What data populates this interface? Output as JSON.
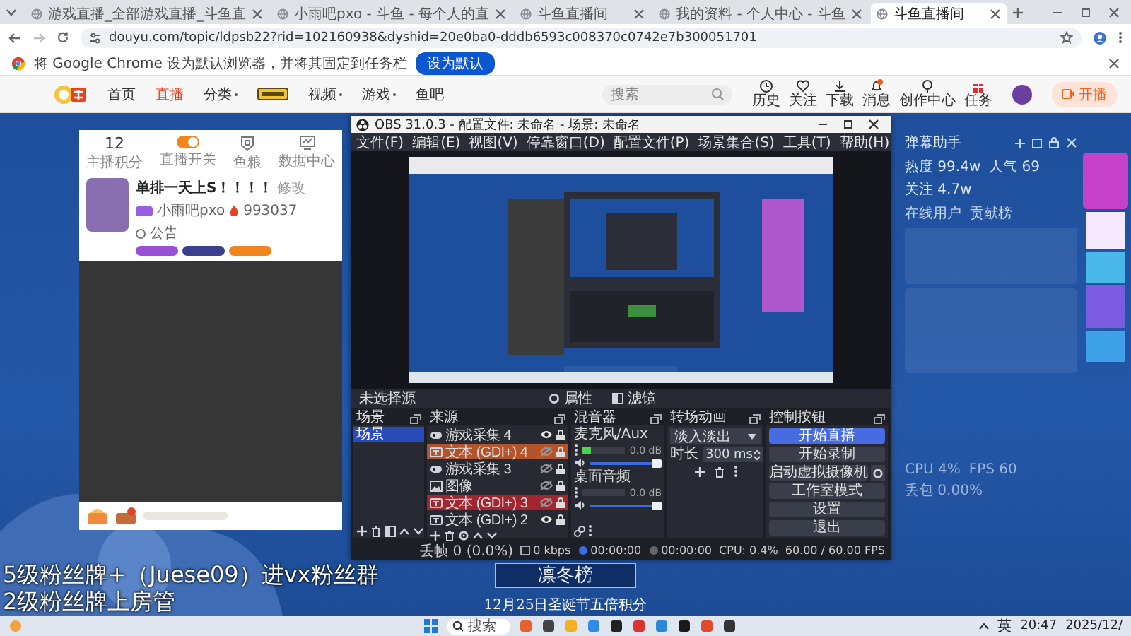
{
  "browser": {
    "tabs": [
      {
        "title": "游戏直播_全部游戏直播_斗鱼直",
        "selected": false
      },
      {
        "title": "小雨吧pxo - 斗鱼 - 每个人的直",
        "selected": false
      },
      {
        "title": "斗鱼直播间",
        "selected": false
      },
      {
        "title": "我的资料 - 个人中心 - 斗鱼",
        "selected": false
      },
      {
        "title": "斗鱼直播间",
        "selected": true
      }
    ],
    "address": "douyu.com/topic/ldpsb22?rid=102160938&dyshid=20e0ba0-dddb6593c008370c0742e7b300051701",
    "default_prompt": {
      "message": "将 Google Chrome 设为默认浏览器，并将其固定到任务栏",
      "button": "设为默认"
    }
  },
  "site_nav": {
    "links": [
      {
        "label": "首页",
        "kind": "link",
        "selected": false
      },
      {
        "label": "直播",
        "kind": "link",
        "selected": true
      },
      {
        "label": "分类",
        "kind": "dropdown",
        "selected": false
      },
      {
        "kind": "promo",
        "selected": false
      },
      {
        "label": "视频",
        "kind": "dropdown",
        "selected": false
      },
      {
        "label": "游戏",
        "kind": "dropdown",
        "selected": false
      },
      {
        "label": "鱼吧",
        "kind": "link",
        "selected": false
      }
    ],
    "search": {
      "placeholder": "搜索"
    },
    "tools": [
      {
        "label": "历史",
        "kind": "history"
      },
      {
        "label": "关注",
        "kind": "heart"
      },
      {
        "label": "下载",
        "kind": "download"
      },
      {
        "label": "消息",
        "kind": "bell"
      },
      {
        "label": "创作中心",
        "kind": "pin"
      },
      {
        "label": "任务",
        "kind": "gift"
      }
    ],
    "start_button": "开播"
  },
  "streamer_panel": {
    "stats": [
      {
        "value": "12",
        "label": "主播积分",
        "kind": "points"
      },
      {
        "label": "直播开关",
        "kind": "toggle",
        "on": true
      },
      {
        "label": "鱼粮",
        "kind": "badge"
      },
      {
        "label": "数据中心",
        "kind": "chart"
      }
    ],
    "room_title": "单排一天上S！！！！",
    "edit": "修改",
    "streamer": "小雨吧pxo",
    "hot": "993037",
    "notice": "公告"
  },
  "obs": {
    "title": "OBS 31.0.3 - 配置文件: 未命名 - 场景: 未命名",
    "menu": [
      "文件(F)",
      "编辑(E)",
      "视图(V)",
      "停靠窗口(D)",
      "配置文件(P)",
      "场景集合(S)",
      "工具(T)",
      "帮助(H)"
    ],
    "source_bar": {
      "status": "未选择源",
      "properties": "属性",
      "filters": "滤镜"
    },
    "scenes": {
      "title": "场景",
      "items": [
        {
          "label": "场景",
          "selected": true
        }
      ]
    },
    "sources": {
      "title": "来源",
      "items": [
        {
          "label": "游戏采集 4",
          "kind": "game",
          "visible": true
        },
        {
          "label": "文本 (GDI+) 4",
          "kind": "text",
          "visible": false,
          "color": "#b5532a"
        },
        {
          "label": "游戏采集 3",
          "kind": "game",
          "visible": false
        },
        {
          "label": "图像",
          "kind": "image",
          "visible": false
        },
        {
          "label": "文本 (GDI+) 3",
          "kind": "text",
          "visible": false,
          "color": "#a3262f"
        },
        {
          "label": "文本 (GDI+) 2",
          "kind": "text",
          "visible": true
        }
      ]
    },
    "mixer": {
      "title": "混音器",
      "channels": [
        {
          "name": "麦克风/Aux",
          "reading": "0.0 dB",
          "meter": {
            "level": 0.2
          },
          "volume": {
            "level": 1
          }
        },
        {
          "name": "桌面音频",
          "reading": "0.0 dB",
          "volume": {
            "level": 1
          }
        }
      ]
    },
    "transitions": {
      "title": "转场动画",
      "type": "淡入淡出",
      "duration_label": "时长",
      "duration": "300 ms"
    },
    "controls": {
      "title": "控制按钮",
      "buttons": [
        {
          "label": "开始直播",
          "highlighted": true,
          "has_settings": false
        },
        {
          "label": "开始录制",
          "highlighted": false,
          "has_settings": false
        },
        {
          "label": "启动虚拟摄像机",
          "highlighted": false,
          "has_settings": true
        },
        {
          "label": "工作室模式",
          "highlighted": false,
          "has_settings": false
        },
        {
          "label": "设置",
          "highlighted": false,
          "has_settings": false
        },
        {
          "label": "退出",
          "highlighted": false,
          "has_settings": false
        }
      ]
    },
    "status_bar": [
      {
        "kind": "dropped",
        "text": "丢帧 0 (0.0%)"
      },
      {
        "kind": "bitrate",
        "text": "0 kbps"
      },
      {
        "kind": "stream",
        "text": "00:00:00"
      },
      {
        "kind": "record",
        "text": "00:00:00"
      },
      {
        "kind": "cpu",
        "text": "CPU: 0.4%"
      },
      {
        "kind": "fps",
        "text": "60.00 / 60.00 FPS"
      }
    ]
  },
  "danmu_panel": {
    "title": "弹幕助手",
    "stats": [
      "热度 99.4w",
      "人气 69",
      "关注 4.7w"
    ],
    "sections": [
      "在线用户",
      "贡献榜"
    ],
    "footer": [
      "CPU 4%",
      "FPS 60",
      "丢包 0.00%"
    ]
  },
  "stream_overlay": {
    "leaderboard": "凛冬榜",
    "event": "12月25日圣诞节五倍积分",
    "captions": [
      "5级粉丝牌+（Juese09）进vx粉丝群",
      "2级粉丝牌上房管"
    ]
  },
  "taskbar": {
    "search_placeholder": "搜索",
    "input_method": "英",
    "time": "20:47",
    "date": "2025/12/"
  }
}
